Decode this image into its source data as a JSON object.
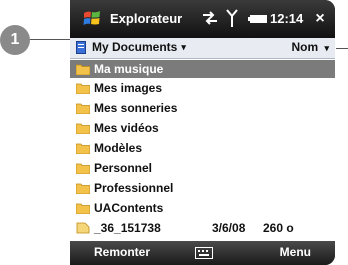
{
  "callout": {
    "number": "1"
  },
  "titlebar": {
    "app_title": "Explorateur",
    "time": "12:14",
    "close": "×"
  },
  "pathbar": {
    "folder": "My Documents",
    "sort": "Nom"
  },
  "list": {
    "items": [
      {
        "name": "Ma musique",
        "date": "",
        "size": "",
        "type": "folder",
        "selected": true
      },
      {
        "name": "Mes images",
        "date": "",
        "size": "",
        "type": "folder"
      },
      {
        "name": "Mes sonneries",
        "date": "",
        "size": "",
        "type": "folder"
      },
      {
        "name": "Mes vidéos",
        "date": "",
        "size": "",
        "type": "folder"
      },
      {
        "name": "Modèles",
        "date": "",
        "size": "",
        "type": "folder"
      },
      {
        "name": "Personnel",
        "date": "",
        "size": "",
        "type": "folder"
      },
      {
        "name": "Professionnel",
        "date": "",
        "size": "",
        "type": "folder"
      },
      {
        "name": "UAContents",
        "date": "",
        "size": "",
        "type": "folder"
      },
      {
        "name": "_36_151738",
        "date": "3/6/08",
        "size": "260 o",
        "type": "file"
      }
    ]
  },
  "softkeys": {
    "left": "Remonter",
    "right": "Menu"
  },
  "colors": {
    "selection": "#7b7b7b",
    "folder": "#f3c24a",
    "titlebar": "#111111"
  }
}
